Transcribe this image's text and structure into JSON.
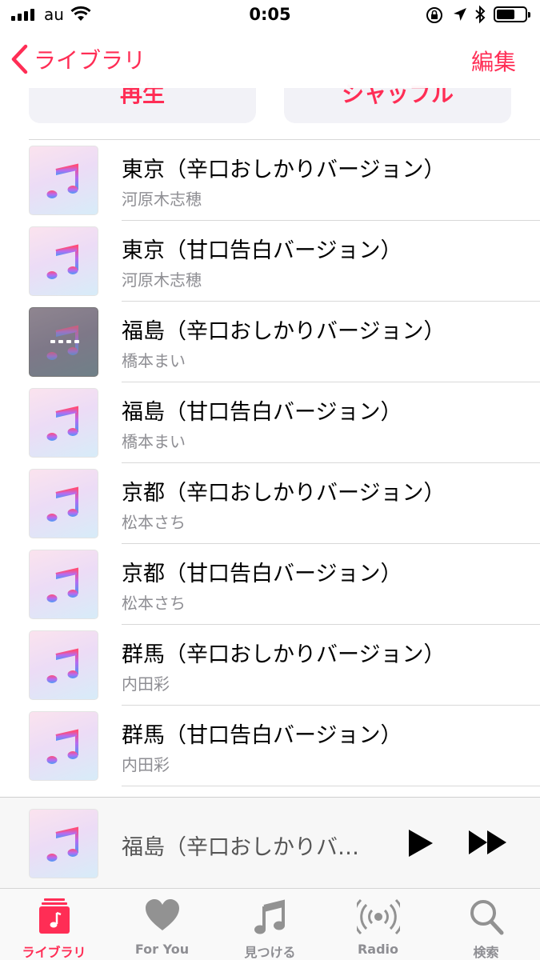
{
  "status_bar": {
    "carrier": "au",
    "time": "0:05"
  },
  "nav": {
    "back_label": "ライブラリ",
    "edit_label": "編集"
  },
  "actions": {
    "play_label": "再生",
    "shuffle_label": "シャッフル"
  },
  "songs": [
    {
      "title": "東京（辛口おしかりバージョン）",
      "artist": "河原木志穂"
    },
    {
      "title": "東京（甘口告白バージョン）",
      "artist": "河原木志穂"
    },
    {
      "title": "福島（辛口おしかりバージョン）",
      "artist": "橋本まい",
      "now_playing": true
    },
    {
      "title": "福島（甘口告白バージョン）",
      "artist": "橋本まい"
    },
    {
      "title": "京都（辛口おしかりバージョン）",
      "artist": "松本さち"
    },
    {
      "title": "京都（甘口告白バージョン）",
      "artist": "松本さち"
    },
    {
      "title": "群馬（辛口おしかりバージョン）",
      "artist": "内田彩"
    },
    {
      "title": "群馬（甘口告白バージョン）",
      "artist": "内田彩"
    }
  ],
  "mini_player": {
    "title": "福島（辛口おしかりバ…"
  },
  "tabs": [
    {
      "label": "ライブラリ",
      "icon": "library-icon",
      "active": true
    },
    {
      "label": "For You",
      "icon": "heart-icon",
      "active": false
    },
    {
      "label": "見つける",
      "icon": "music-note-icon",
      "active": false
    },
    {
      "label": "Radio",
      "icon": "radio-icon",
      "active": false
    },
    {
      "label": "検索",
      "icon": "search-icon",
      "active": false
    }
  ],
  "colors": {
    "accent": "#ff2d55",
    "secondary_text": "#8e8e93",
    "separator": "#d8d8d8"
  }
}
